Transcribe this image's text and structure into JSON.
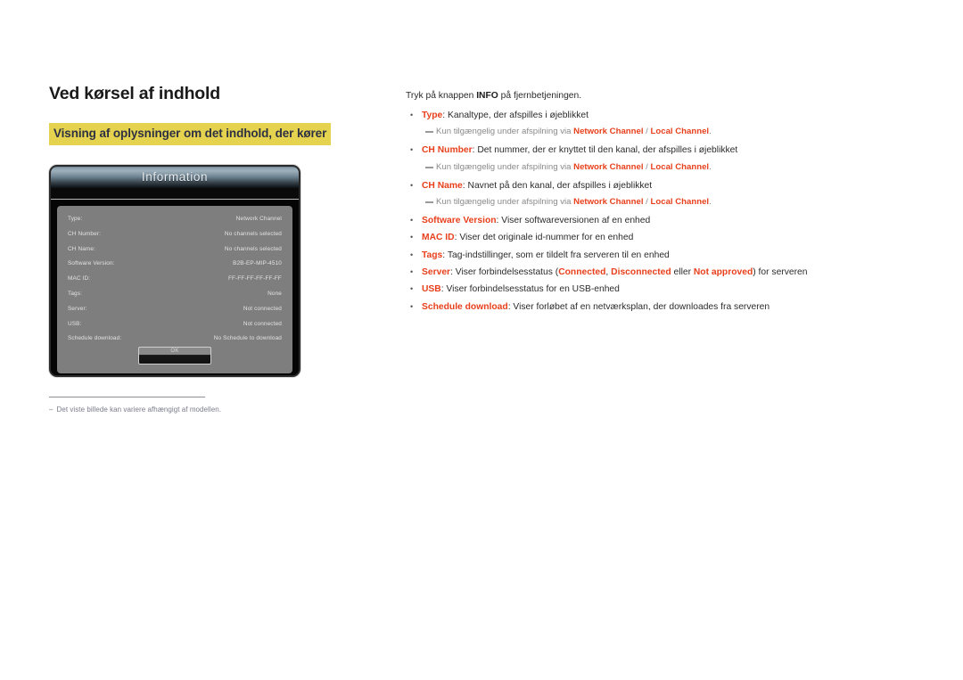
{
  "page": {
    "title": "Ved kørsel af indhold",
    "section_heading": "Visning af oplysninger om det indhold, der kører"
  },
  "dialog": {
    "title": "Information",
    "ok_label": "OK",
    "rows": [
      {
        "label": "Type:",
        "value": "Network Channel"
      },
      {
        "label": "CH Number:",
        "value": "No channels selected"
      },
      {
        "label": "CH Name:",
        "value": "No channels selected"
      },
      {
        "label": "Software Version:",
        "value": "B2B-EP-MIP-4510"
      },
      {
        "label": "MAC ID:",
        "value": "FF-FF-FF-FF-FF-FF"
      },
      {
        "label": "Tags:",
        "value": "None"
      },
      {
        "label": "Server:",
        "value": "Not connected"
      },
      {
        "label": "USB:",
        "value": "Not connected"
      },
      {
        "label": "Schedule download:",
        "value": "No Schedule to download"
      }
    ]
  },
  "footnote": {
    "dash": "–",
    "text": "Det viste billede kan variere afhængigt af modellen."
  },
  "instructions": {
    "intro_before": "Tryk på knappen ",
    "intro_key": "INFO",
    "intro_after": " på fjernbetjeningen.",
    "bullet_marker": "•",
    "items": [
      {
        "term": "Type",
        "desc": ": Kanaltype, der afspilles i øjeblikket",
        "subnote": {
          "before": "Kun tilgængelig under afspilning via ",
          "kw1": "Network Channel",
          "sep": " / ",
          "kw2": "Local Channel",
          "after": "."
        }
      },
      {
        "term": "CH Number",
        "desc": ": Det nummer, der er knyttet til den kanal, der afspilles i øjeblikket",
        "subnote": {
          "before": "Kun tilgængelig under afspilning via ",
          "kw1": "Network Channel",
          "sep": " / ",
          "kw2": "Local Channel",
          "after": "."
        }
      },
      {
        "term": "CH Name",
        "desc": ": Navnet på den kanal, der afspilles i øjeblikket",
        "subnote": {
          "before": "Kun tilgængelig under afspilning via ",
          "kw1": "Network Channel",
          "sep": " / ",
          "kw2": "Local Channel",
          "after": "."
        }
      },
      {
        "term": "Software Version",
        "desc": ": Viser softwareversionen af en enhed",
        "subnote": null
      },
      {
        "term": "MAC ID",
        "desc": ": Viser det originale id-nummer for en enhed",
        "subnote": null
      },
      {
        "term": "Tags",
        "desc": ": Tag-indstillinger, som er tildelt fra serveren til en enhed",
        "subnote": null
      },
      {
        "term": "Server",
        "desc_parts": {
          "p1": ": Viser forbindelsesstatus (",
          "kw1": "Connected",
          "p2": ", ",
          "kw2": "Disconnected",
          "p3": " eller ",
          "kw3": "Not approved",
          "p4": ") for serveren"
        },
        "subnote": null
      },
      {
        "term": "USB",
        "desc": ": Viser forbindelsesstatus for en USB-enhed",
        "subnote": null
      },
      {
        "term": "Schedule download",
        "desc": ": Viser forløbet af en netværksplan, der downloades fra serveren",
        "subnote": null
      }
    ]
  },
  "colors": {
    "accent_red": "#e8401c",
    "highlight_yellow": "#e5d24e",
    "heading_navy": "#2d3142",
    "footnote_gray": "#7b7b8c"
  }
}
